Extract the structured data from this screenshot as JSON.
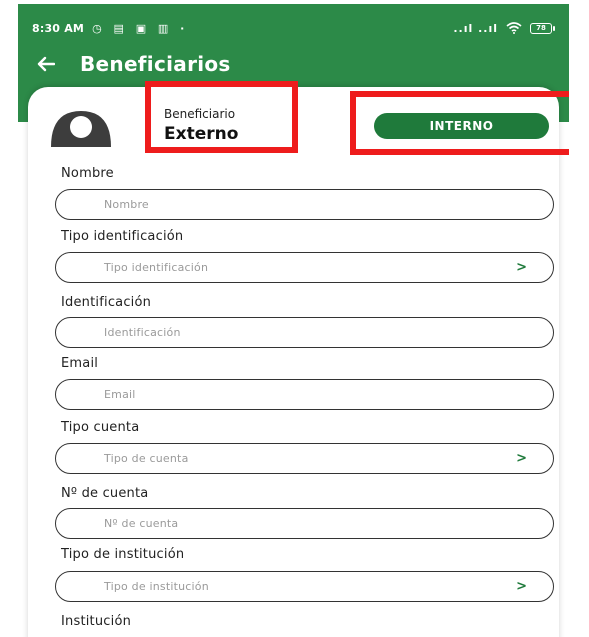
{
  "status_bar": {
    "time": "8:30 AM",
    "notif_icons": "◷ ▤ ▣ ▥ ·",
    "signal": "..ıl ..ıl",
    "battery": "78"
  },
  "header": {
    "title": "Beneficiarios"
  },
  "beneficiary_type": {
    "label": "Beneficiario",
    "value": "Externo",
    "toggle_label": "INTERNO"
  },
  "form": {
    "fields": [
      {
        "label": "Nombre",
        "placeholder": "Nombre",
        "has_chevron": false
      },
      {
        "label": "Tipo identificación",
        "placeholder": "Tipo identificación",
        "has_chevron": true
      },
      {
        "label": "Identificación",
        "placeholder": "Identificación",
        "has_chevron": false
      },
      {
        "label": "Email",
        "placeholder": "Email",
        "has_chevron": false
      },
      {
        "label": "Tipo cuenta",
        "placeholder": "Tipo de cuenta",
        "has_chevron": true
      },
      {
        "label": "Nº de cuenta",
        "placeholder": "Nº de cuenta",
        "has_chevron": false
      },
      {
        "label": "Tipo de institución",
        "placeholder": "Tipo de institución",
        "has_chevron": true
      },
      {
        "label": "Institución",
        "placeholder": "",
        "has_chevron": false
      }
    ],
    "chevron": ">"
  },
  "colors": {
    "header_green": "#2c8a48",
    "button_green": "#1f7a3b",
    "highlight_red": "#ee1c1c"
  }
}
